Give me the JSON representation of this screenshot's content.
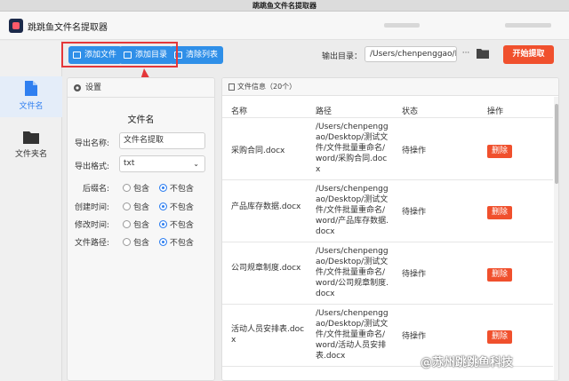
{
  "window": {
    "title": "跳跳鱼文件名提取器"
  },
  "header": {
    "app_name": "跳跳鱼文件名提取器"
  },
  "sidebar": {
    "items": [
      {
        "label": "文件名"
      },
      {
        "label": "文件夹名"
      }
    ]
  },
  "toolbar": {
    "add_file": "添加文件",
    "add_dir": "添加目录",
    "clear_list": "清除列表",
    "output_label": "输出目录：",
    "output_path": "/Users/chenpenggao/D",
    "more_label": "···",
    "start_label": "开始提取"
  },
  "settings": {
    "title": "设置",
    "section": "文件名",
    "export_name_label": "导出名称:",
    "export_name_value": "文件名提取",
    "export_format_label": "导出格式:",
    "export_format_value": "txt",
    "options": [
      {
        "label": "后缀名:",
        "include": "包含",
        "exclude": "不包含"
      },
      {
        "label": "创建时间:",
        "include": "包含",
        "exclude": "不包含"
      },
      {
        "label": "修改时间:",
        "include": "包含",
        "exclude": "不包含"
      },
      {
        "label": "文件路径:",
        "include": "包含",
        "exclude": "不包含"
      }
    ]
  },
  "files": {
    "header": "文件信息（20个）",
    "columns": {
      "name": "名称",
      "path": "路径",
      "status": "状态",
      "action": "操作"
    },
    "rows": [
      {
        "name": "采购合同.docx",
        "path": "/Users/chenpenggao/Desktop/测试文件/文件批量重命名/word/采购合同.docx",
        "status": "待操作",
        "action": "删除"
      },
      {
        "name": "产品库存数据.docx",
        "path": "/Users/chenpenggao/Desktop/测试文件/文件批量重命名/word/产品库存数据.docx",
        "status": "待操作",
        "action": "删除"
      },
      {
        "name": "公司规章制度.docx",
        "path": "/Users/chenpenggao/Desktop/测试文件/文件批量重命名/word/公司规章制度.docx",
        "status": "待操作",
        "action": "删除"
      },
      {
        "name": "活动人员安排表.docx",
        "path": "/Users/chenpenggao/Desktop/测试文件/文件批量重命名/word/活动人员安排表.docx",
        "status": "待操作",
        "action": "删除"
      }
    ]
  },
  "watermark": "@苏州跳跳鱼科技",
  "colors": {
    "accent_blue": "#2f8fe8",
    "start_orange": "#f0502d",
    "highlight_red": "#e4373a"
  }
}
